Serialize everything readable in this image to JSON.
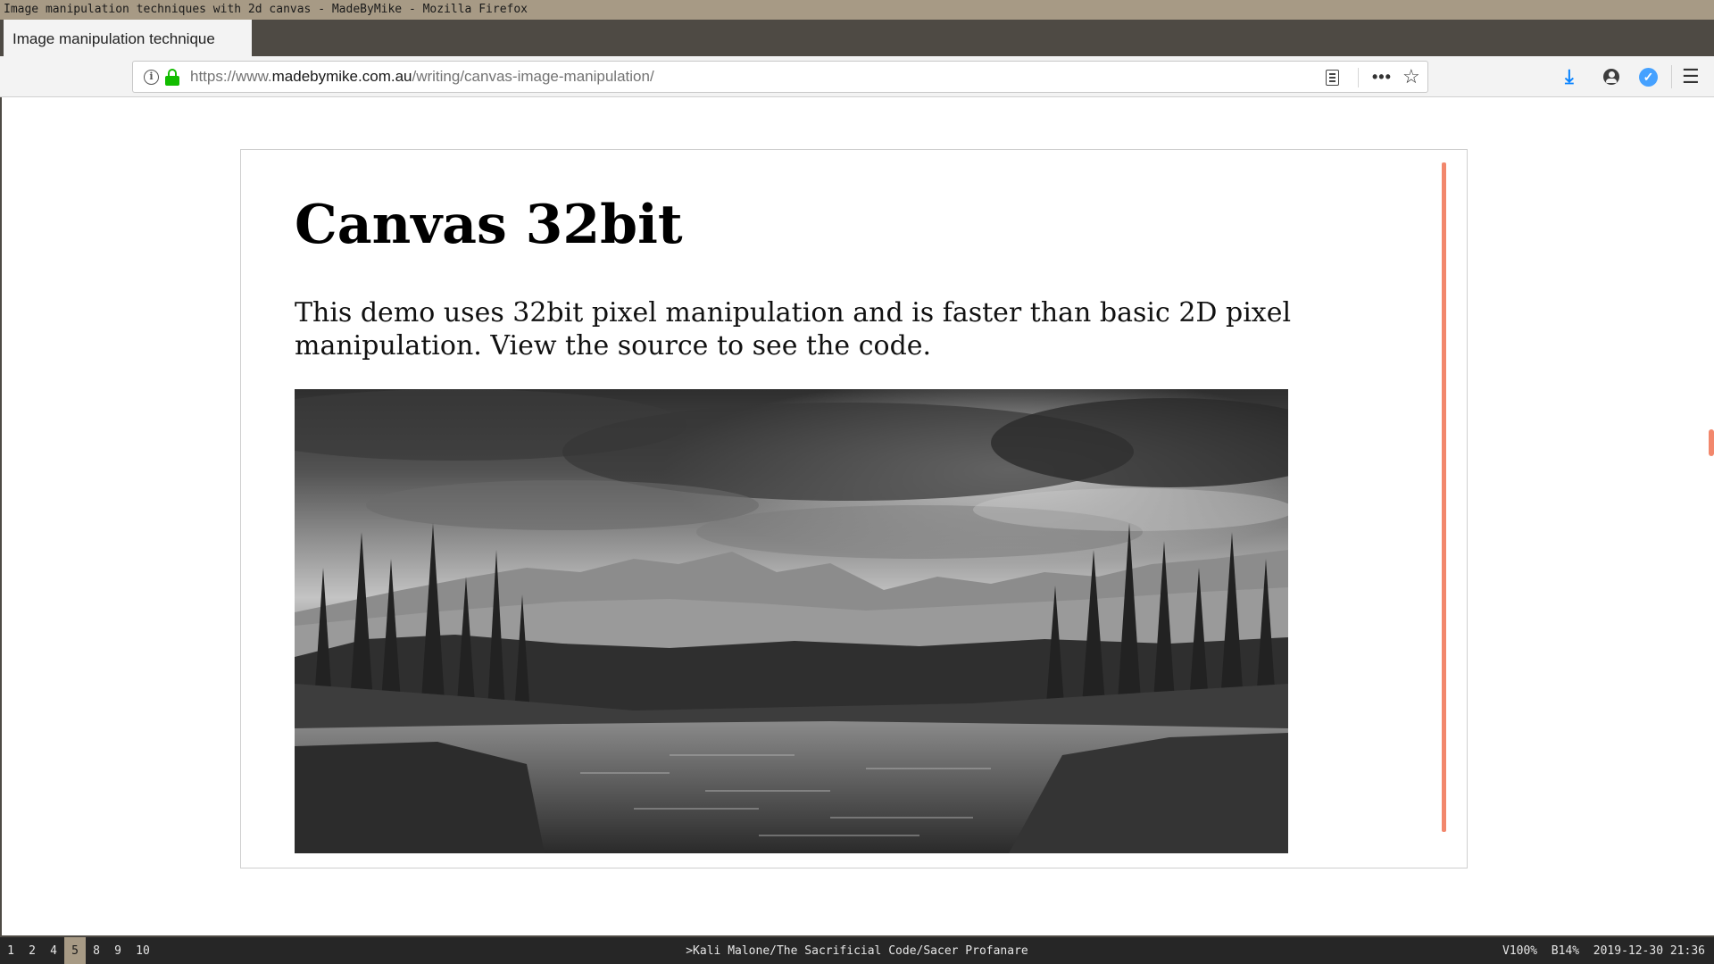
{
  "window": {
    "title": "Image manipulation techniques with 2d canvas - MadeByMike - Mozilla Firefox"
  },
  "tab": {
    "label": "Image manipulation technique"
  },
  "urlbar": {
    "prefix": "https://www.",
    "host": "madebymike.com.au",
    "path": "/writing/canvas-image-manipulation/"
  },
  "icons": {
    "info": "info-icon",
    "lock": "lock-icon",
    "reader": "reader-view-icon",
    "more": "more-actions-icon",
    "star": "bookmark-star-icon",
    "download": "download-icon",
    "account": "account-icon",
    "extension": "extension-icon",
    "menu": "hamburger-menu-icon"
  },
  "glyphs": {
    "info": "i",
    "more": "•••",
    "star": "☆",
    "download": "⤓",
    "extension": "✓",
    "menu": "☰"
  },
  "page": {
    "title": "Canvas 32bit",
    "description": "This demo uses 32bit pixel manipulation and is faster than basic 2D pixel manipulation. View the source to see the code."
  },
  "colors": {
    "accent": "#f2876c",
    "lock_green": "#12bc00",
    "download_blue": "#0a84ff"
  },
  "statusbar": {
    "workspaces": [
      {
        "label": "1",
        "active": false
      },
      {
        "label": "2",
        "active": false
      },
      {
        "label": "4",
        "active": false
      },
      {
        "label": "5",
        "active": true
      },
      {
        "label": "8",
        "active": false
      },
      {
        "label": "9",
        "active": false
      },
      {
        "label": "10",
        "active": false
      }
    ],
    "now_playing": ">Kali Malone/The Sacrificial Code/Sacer Profanare",
    "volume": "V100%",
    "battery": "B14%",
    "datetime": "2019-12-30 21:36"
  }
}
